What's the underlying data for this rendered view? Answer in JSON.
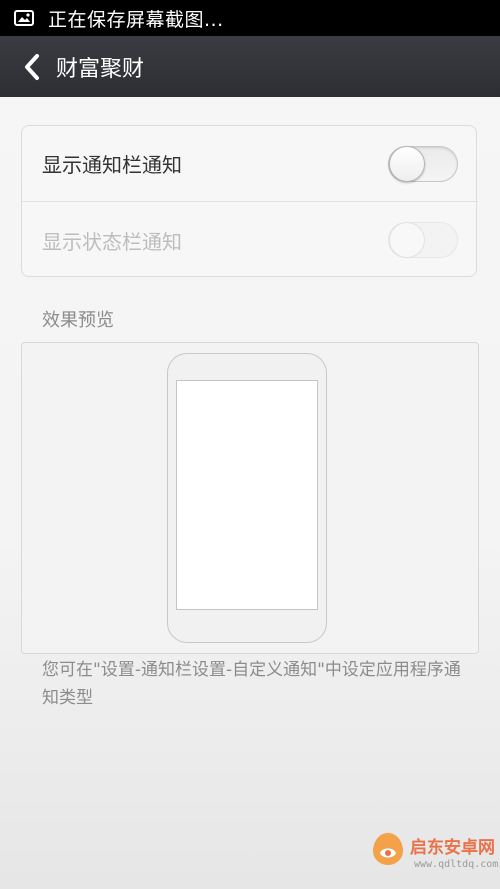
{
  "status_bar": {
    "text": "正在保存屏幕截图...",
    "icon": "image-icon"
  },
  "header": {
    "back_icon": "chevron-left-icon",
    "title": "财富聚财"
  },
  "settings": {
    "items": [
      {
        "label": "显示通知栏通知",
        "enabled": true,
        "on": false
      },
      {
        "label": "显示状态栏通知",
        "enabled": false,
        "on": false
      }
    ]
  },
  "preview": {
    "title": "效果预览"
  },
  "hint": {
    "text": "您可在\"设置-通知栏设置-自定义通知\"中设定应用程序通知类型"
  },
  "watermark": {
    "brand": "启东安卓网",
    "url": "www.qdltdq.com"
  },
  "colors": {
    "status_bar_bg": "#000000",
    "title_bar_bg": "#2f3136",
    "page_bg": "#f4f4f4",
    "watermark_accent": "#e8734b"
  }
}
